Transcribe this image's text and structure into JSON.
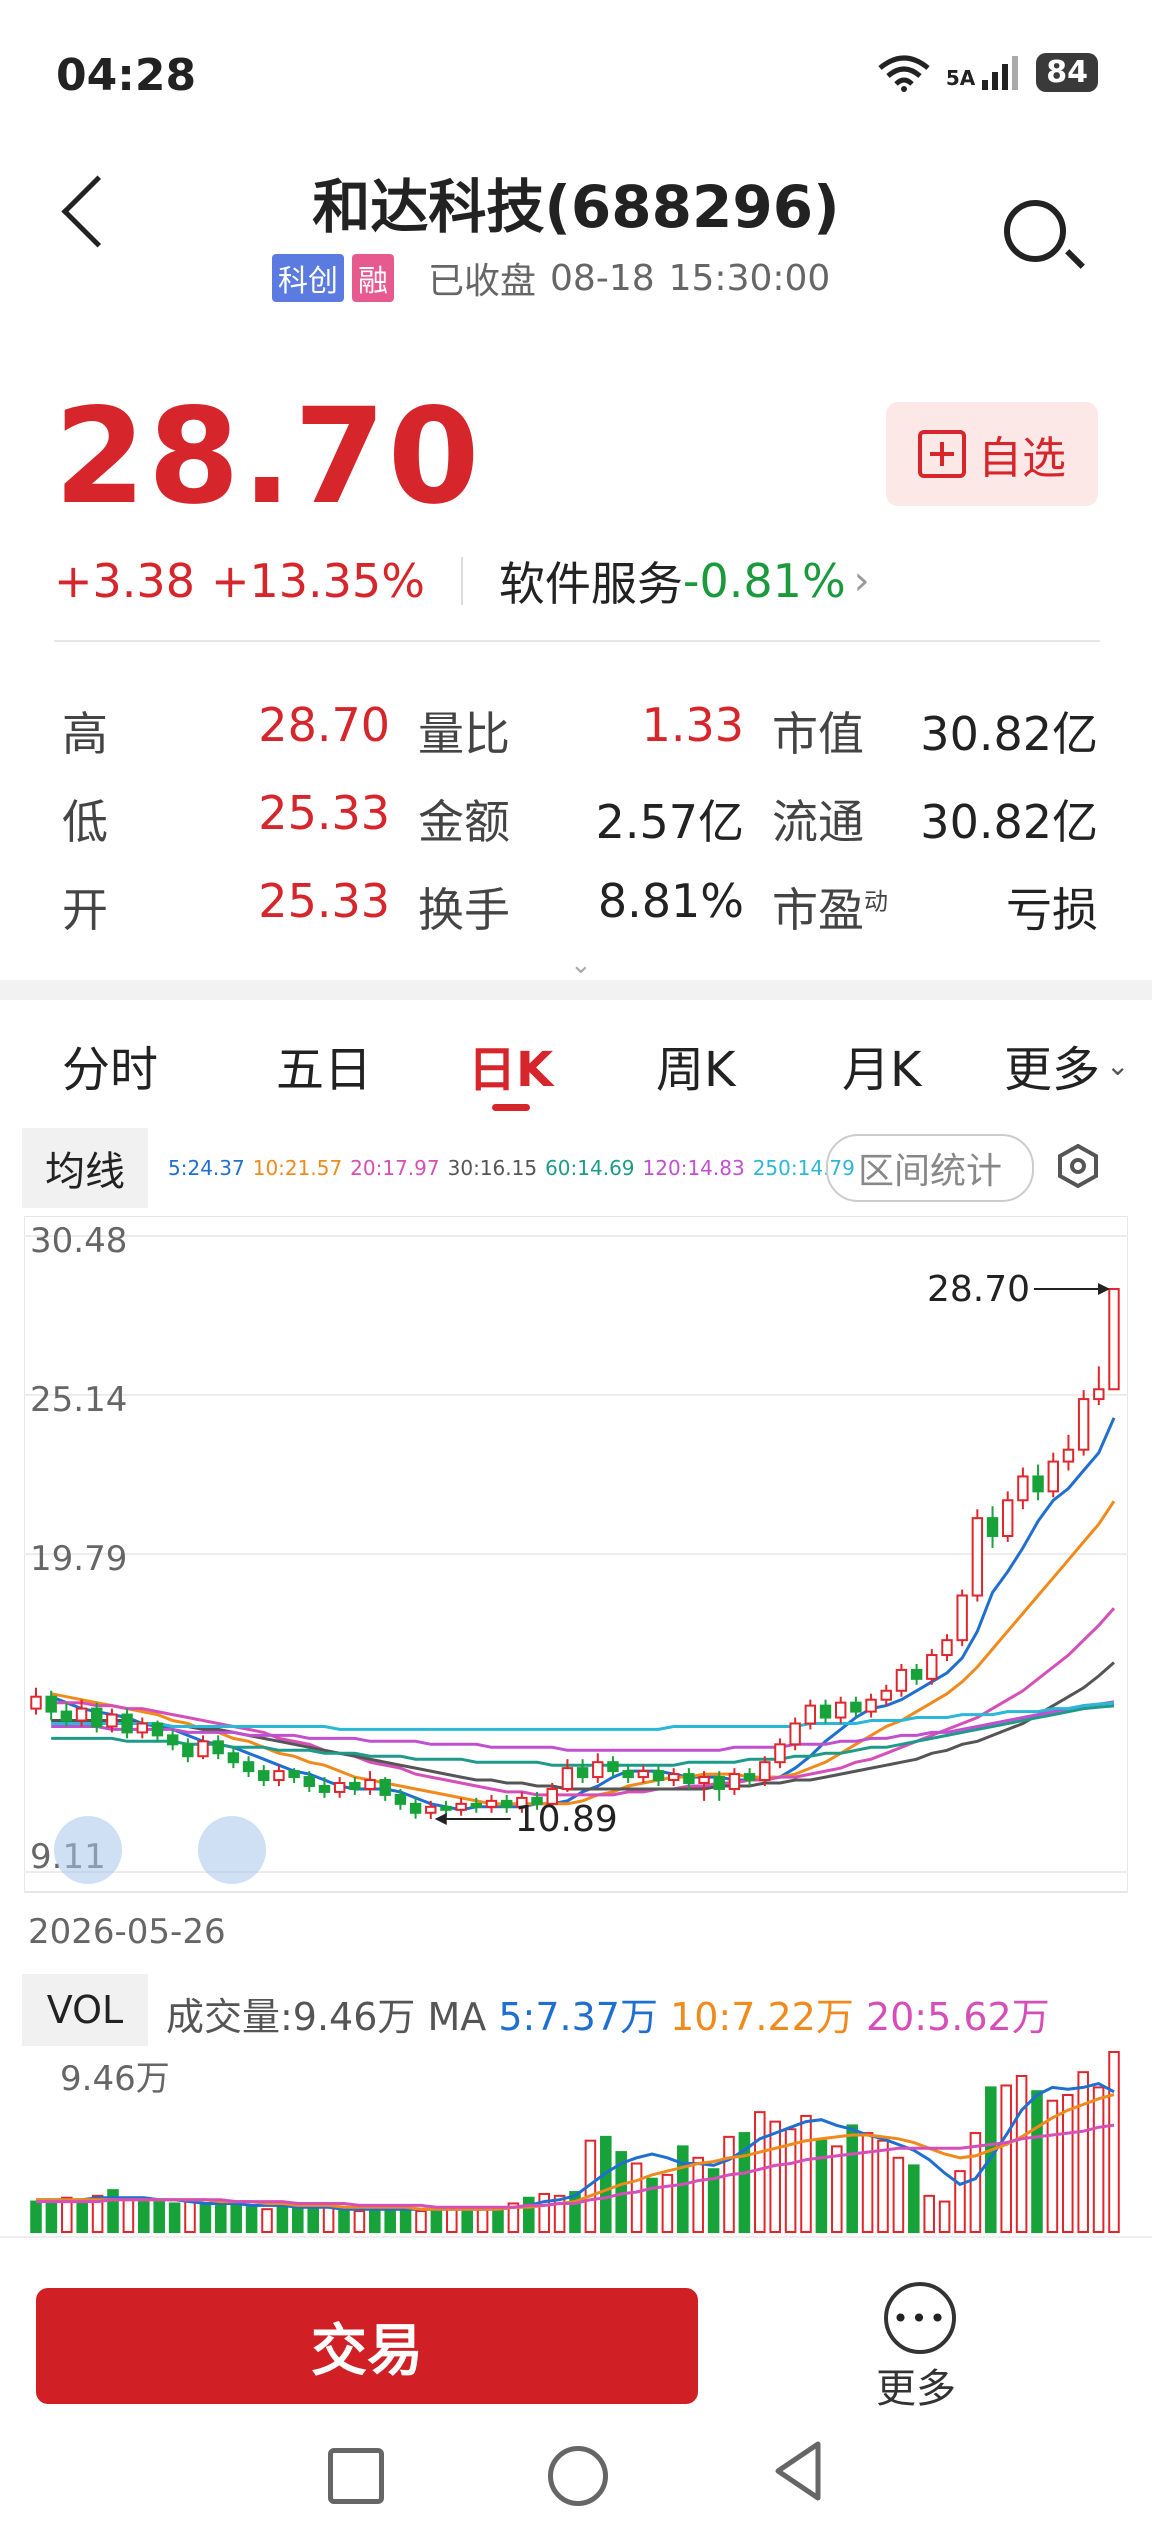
{
  "status": {
    "time": "04:28",
    "network": "5A",
    "battery": "84"
  },
  "header": {
    "title": "和达科技(688296)",
    "tag1": "科创",
    "tag2": "融",
    "status": "已收盘",
    "date": "08-18",
    "time": "15:30:00"
  },
  "quote": {
    "price": "28.70",
    "change": "+3.38",
    "change_pct": "+13.35%",
    "sector": "软件服务",
    "sector_change": "-0.81%",
    "watch_label": "自选"
  },
  "stats": [
    {
      "label": "高",
      "value": "28.70",
      "label2": "量比",
      "value2": "1.33",
      "label3": "市值",
      "value3": "30.82亿"
    },
    {
      "label": "低",
      "value": "25.33",
      "label2": "金额",
      "value2": "2.57亿",
      "label3": "流通",
      "value3": "30.82亿"
    },
    {
      "label": "开",
      "value": "25.33",
      "label2": "换手",
      "value2": "8.81%",
      "label3": "市盈",
      "label3_sup": "动",
      "value3": "亏损"
    }
  ],
  "tabs": [
    "分时",
    "五日",
    "日K",
    "周K",
    "月K",
    "更多"
  ],
  "active_tab": "日K",
  "ma": {
    "label": "均线",
    "values": [
      {
        "text": "5:24.37",
        "color": "#1f6fd1"
      },
      {
        "text": "10:21.57",
        "color": "#f08a1c"
      },
      {
        "text": "20:17.97",
        "color": "#d64fb8"
      },
      {
        "text": "30:16.15",
        "color": "#555555"
      },
      {
        "text": "60:14.69",
        "color": "#1e9a8a"
      },
      {
        "text": "120:14.83",
        "color": "#c050d0"
      },
      {
        "text": "250:14.79",
        "color": "#2ab7d8"
      }
    ],
    "range_button": "区间统计"
  },
  "chart_data": {
    "type": "candlestick",
    "y_ticks": [
      "30.48",
      "25.14",
      "19.79",
      "9.11"
    ],
    "ylim": [
      9.11,
      30.48
    ],
    "high_annotation": "28.70",
    "low_annotation": "10.89",
    "start_date": "2026-05-26",
    "candles": [
      {
        "o": 14.6,
        "c": 15.0,
        "h": 15.3,
        "l": 14.4
      },
      {
        "o": 15.0,
        "c": 14.5,
        "h": 15.2,
        "l": 14.2
      },
      {
        "o": 14.5,
        "c": 14.2,
        "h": 14.8,
        "l": 14.0
      },
      {
        "o": 14.2,
        "c": 14.6,
        "h": 14.9,
        "l": 14.0
      },
      {
        "o": 14.6,
        "c": 14.0,
        "h": 14.8,
        "l": 13.8
      },
      {
        "o": 14.0,
        "c": 14.4,
        "h": 14.6,
        "l": 13.8
      },
      {
        "o": 14.4,
        "c": 13.8,
        "h": 14.6,
        "l": 13.6
      },
      {
        "o": 13.8,
        "c": 14.1,
        "h": 14.3,
        "l": 13.6
      },
      {
        "o": 14.1,
        "c": 13.7,
        "h": 14.2,
        "l": 13.5
      },
      {
        "o": 13.7,
        "c": 13.4,
        "h": 13.9,
        "l": 13.2
      },
      {
        "o": 13.4,
        "c": 13.0,
        "h": 13.6,
        "l": 12.8
      },
      {
        "o": 13.0,
        "c": 13.5,
        "h": 13.7,
        "l": 12.9
      },
      {
        "o": 13.5,
        "c": 13.1,
        "h": 13.7,
        "l": 12.9
      },
      {
        "o": 13.1,
        "c": 12.8,
        "h": 13.3,
        "l": 12.6
      },
      {
        "o": 12.8,
        "c": 12.5,
        "h": 13.0,
        "l": 12.3
      },
      {
        "o": 12.5,
        "c": 12.2,
        "h": 12.7,
        "l": 12.0
      },
      {
        "o": 12.2,
        "c": 12.5,
        "h": 12.7,
        "l": 12.0
      },
      {
        "o": 12.5,
        "c": 12.3,
        "h": 12.6,
        "l": 12.1
      },
      {
        "o": 12.3,
        "c": 12.0,
        "h": 12.5,
        "l": 11.8
      },
      {
        "o": 12.0,
        "c": 11.8,
        "h": 12.3,
        "l": 11.6
      },
      {
        "o": 11.8,
        "c": 12.1,
        "h": 12.3,
        "l": 11.6
      },
      {
        "o": 12.1,
        "c": 11.9,
        "h": 12.3,
        "l": 11.7
      },
      {
        "o": 11.9,
        "c": 12.2,
        "h": 12.5,
        "l": 11.7
      },
      {
        "o": 12.2,
        "c": 11.7,
        "h": 12.3,
        "l": 11.5
      },
      {
        "o": 11.7,
        "c": 11.4,
        "h": 11.9,
        "l": 11.2
      },
      {
        "o": 11.4,
        "c": 11.1,
        "h": 11.6,
        "l": 10.9
      },
      {
        "o": 11.1,
        "c": 11.3,
        "h": 11.5,
        "l": 10.89
      },
      {
        "o": 11.3,
        "c": 11.2,
        "h": 11.5,
        "l": 11.0
      },
      {
        "o": 11.2,
        "c": 11.4,
        "h": 11.6,
        "l": 11.0
      },
      {
        "o": 11.4,
        "c": 11.3,
        "h": 11.6,
        "l": 11.1
      },
      {
        "o": 11.3,
        "c": 11.5,
        "h": 11.7,
        "l": 11.1
      },
      {
        "o": 11.5,
        "c": 11.3,
        "h": 11.7,
        "l": 11.1
      },
      {
        "o": 11.3,
        "c": 11.6,
        "h": 11.8,
        "l": 11.1
      },
      {
        "o": 11.6,
        "c": 11.4,
        "h": 11.8,
        "l": 11.2
      },
      {
        "o": 11.4,
        "c": 11.9,
        "h": 12.1,
        "l": 11.3
      },
      {
        "o": 11.9,
        "c": 12.6,
        "h": 12.9,
        "l": 11.8
      },
      {
        "o": 12.6,
        "c": 12.3,
        "h": 12.9,
        "l": 12.1
      },
      {
        "o": 12.3,
        "c": 12.8,
        "h": 13.1,
        "l": 12.1
      },
      {
        "o": 12.8,
        "c": 12.5,
        "h": 13.0,
        "l": 12.3
      },
      {
        "o": 12.5,
        "c": 12.3,
        "h": 12.7,
        "l": 12.1
      },
      {
        "o": 12.3,
        "c": 12.5,
        "h": 12.7,
        "l": 12.1
      },
      {
        "o": 12.5,
        "c": 12.2,
        "h": 12.7,
        "l": 12.0
      },
      {
        "o": 12.2,
        "c": 12.4,
        "h": 12.6,
        "l": 12.0
      },
      {
        "o": 12.4,
        "c": 12.1,
        "h": 12.6,
        "l": 11.9
      },
      {
        "o": 12.1,
        "c": 12.3,
        "h": 12.5,
        "l": 11.5
      },
      {
        "o": 12.3,
        "c": 11.9,
        "h": 12.5,
        "l": 11.5
      },
      {
        "o": 11.9,
        "c": 12.4,
        "h": 12.6,
        "l": 11.7
      },
      {
        "o": 12.4,
        "c": 12.2,
        "h": 12.6,
        "l": 12.0
      },
      {
        "o": 12.2,
        "c": 12.8,
        "h": 13.0,
        "l": 12.0
      },
      {
        "o": 12.8,
        "c": 13.4,
        "h": 13.6,
        "l": 12.6
      },
      {
        "o": 13.4,
        "c": 14.1,
        "h": 14.3,
        "l": 13.2
      },
      {
        "o": 14.1,
        "c": 14.7,
        "h": 14.9,
        "l": 13.9
      },
      {
        "o": 14.7,
        "c": 14.3,
        "h": 14.9,
        "l": 14.1
      },
      {
        "o": 14.3,
        "c": 14.8,
        "h": 15.0,
        "l": 14.1
      },
      {
        "o": 14.8,
        "c": 14.5,
        "h": 15.0,
        "l": 14.3
      },
      {
        "o": 14.5,
        "c": 14.9,
        "h": 15.1,
        "l": 14.3
      },
      {
        "o": 14.9,
        "c": 15.2,
        "h": 15.4,
        "l": 14.7
      },
      {
        "o": 15.2,
        "c": 15.9,
        "h": 16.1,
        "l": 15.0
      },
      {
        "o": 15.9,
        "c": 15.6,
        "h": 16.1,
        "l": 15.4
      },
      {
        "o": 15.6,
        "c": 16.4,
        "h": 16.6,
        "l": 15.4
      },
      {
        "o": 16.4,
        "c": 16.9,
        "h": 17.1,
        "l": 16.2
      },
      {
        "o": 16.9,
        "c": 18.4,
        "h": 18.6,
        "l": 16.7
      },
      {
        "o": 18.4,
        "c": 21.0,
        "h": 21.3,
        "l": 18.2
      },
      {
        "o": 21.0,
        "c": 20.4,
        "h": 21.4,
        "l": 20.0
      },
      {
        "o": 20.4,
        "c": 21.6,
        "h": 21.9,
        "l": 20.2
      },
      {
        "o": 21.6,
        "c": 22.4,
        "h": 22.7,
        "l": 21.3
      },
      {
        "o": 22.4,
        "c": 21.9,
        "h": 22.8,
        "l": 21.6
      },
      {
        "o": 21.9,
        "c": 22.9,
        "h": 23.2,
        "l": 21.7
      },
      {
        "o": 22.9,
        "c": 23.3,
        "h": 23.8,
        "l": 22.6
      },
      {
        "o": 23.3,
        "c": 25.0,
        "h": 25.3,
        "l": 23.1
      },
      {
        "o": 25.0,
        "c": 25.33,
        "h": 26.1,
        "l": 24.8
      },
      {
        "o": 25.33,
        "c": 28.7,
        "h": 28.7,
        "l": 25.33
      }
    ],
    "ma_lines": {
      "ma5": [
        15.0,
        14.8,
        14.6,
        14.5,
        14.4,
        14.3,
        14.1,
        14.0,
        13.9,
        13.7,
        13.5,
        13.4,
        13.3,
        13.1,
        12.9,
        12.7,
        12.5,
        12.4,
        12.2,
        12.0,
        11.9,
        11.9,
        11.9,
        11.8,
        11.6,
        11.4,
        11.3,
        11.2,
        11.3,
        11.3,
        11.3,
        11.3,
        11.4,
        11.4,
        11.5,
        11.8,
        12.0,
        12.3,
        12.5,
        12.5,
        12.5,
        12.4,
        12.3,
        12.3,
        12.3,
        12.2,
        12.2,
        12.2,
        12.3,
        12.6,
        13.0,
        13.5,
        13.9,
        14.3,
        14.6,
        14.7,
        14.9,
        15.2,
        15.5,
        15.8,
        16.3,
        17.2,
        18.5,
        19.2,
        20.0,
        20.9,
        21.6,
        22.0,
        22.6,
        23.2,
        24.37
      ],
      "ma10": [
        15.1,
        15.0,
        14.9,
        14.8,
        14.7,
        14.6,
        14.5,
        14.4,
        14.2,
        14.1,
        13.9,
        13.8,
        13.6,
        13.5,
        13.3,
        13.1,
        13.0,
        12.8,
        12.7,
        12.5,
        12.3,
        12.2,
        12.1,
        12.0,
        11.9,
        11.8,
        11.7,
        11.6,
        11.5,
        11.4,
        11.4,
        11.4,
        11.4,
        11.4,
        11.4,
        11.5,
        11.7,
        11.8,
        12.0,
        12.1,
        12.2,
        12.3,
        12.3,
        12.4,
        12.4,
        12.4,
        12.3,
        12.3,
        12.3,
        12.4,
        12.6,
        12.8,
        13.1,
        13.4,
        13.7,
        14.0,
        14.2,
        14.5,
        14.8,
        15.1,
        15.5,
        16.0,
        16.6,
        17.2,
        17.8,
        18.4,
        19.0,
        19.6,
        20.2,
        20.8,
        21.57
      ],
      "ma20": [
        14.8,
        14.8,
        14.8,
        14.7,
        14.7,
        14.6,
        14.6,
        14.5,
        14.4,
        14.3,
        14.2,
        14.1,
        14.0,
        13.9,
        13.8,
        13.6,
        13.5,
        13.4,
        13.2,
        13.1,
        13.0,
        12.8,
        12.7,
        12.6,
        12.4,
        12.3,
        12.2,
        12.1,
        12.0,
        11.9,
        11.8,
        11.8,
        11.7,
        11.7,
        11.7,
        11.7,
        11.7,
        11.7,
        11.8,
        11.8,
        11.9,
        11.9,
        12.0,
        12.0,
        12.1,
        12.1,
        12.2,
        12.2,
        12.3,
        12.3,
        12.4,
        12.5,
        12.6,
        12.8,
        12.9,
        13.1,
        13.3,
        13.5,
        13.7,
        13.9,
        14.1,
        14.3,
        14.6,
        14.9,
        15.2,
        15.6,
        16.0,
        16.4,
        16.9,
        17.4,
        17.97
      ],
      "ma30": [
        14.2,
        14.2,
        14.2,
        14.2,
        14.2,
        14.2,
        14.1,
        14.1,
        14.0,
        14.0,
        13.9,
        13.9,
        13.8,
        13.7,
        13.6,
        13.5,
        13.4,
        13.3,
        13.2,
        13.1,
        13.0,
        12.9,
        12.8,
        12.7,
        12.6,
        12.5,
        12.4,
        12.3,
        12.2,
        12.2,
        12.1,
        12.1,
        12.0,
        12.0,
        11.9,
        11.9,
        11.9,
        11.9,
        11.9,
        11.9,
        11.9,
        11.9,
        11.9,
        11.9,
        12.0,
        12.0,
        12.0,
        12.1,
        12.1,
        12.2,
        12.2,
        12.3,
        12.4,
        12.5,
        12.6,
        12.7,
        12.8,
        12.9,
        13.1,
        13.2,
        13.4,
        13.5,
        13.7,
        13.9,
        14.1,
        14.4,
        14.7,
        15.0,
        15.3,
        15.7,
        16.15
      ],
      "ma60": [
        13.6,
        13.6,
        13.6,
        13.6,
        13.6,
        13.5,
        13.5,
        13.5,
        13.5,
        13.4,
        13.4,
        13.4,
        13.3,
        13.3,
        13.3,
        13.2,
        13.2,
        13.2,
        13.1,
        13.1,
        13.1,
        13.0,
        13.0,
        13.0,
        12.9,
        12.9,
        12.9,
        12.9,
        12.8,
        12.8,
        12.8,
        12.8,
        12.8,
        12.7,
        12.7,
        12.7,
        12.7,
        12.7,
        12.7,
        12.7,
        12.7,
        12.7,
        12.8,
        12.8,
        12.8,
        12.8,
        12.9,
        12.9,
        12.9,
        13.0,
        13.0,
        13.1,
        13.1,
        13.2,
        13.3,
        13.3,
        13.4,
        13.5,
        13.6,
        13.7,
        13.8,
        13.9,
        14.0,
        14.1,
        14.2,
        14.3,
        14.4,
        14.5,
        14.6,
        14.65,
        14.69
      ],
      "ma120": [
        14.0,
        14.0,
        14.0,
        14.0,
        13.9,
        13.9,
        13.9,
        13.9,
        13.9,
        13.8,
        13.8,
        13.8,
        13.8,
        13.7,
        13.7,
        13.7,
        13.7,
        13.6,
        13.6,
        13.6,
        13.6,
        13.5,
        13.5,
        13.5,
        13.5,
        13.4,
        13.4,
        13.4,
        13.4,
        13.3,
        13.3,
        13.3,
        13.3,
        13.3,
        13.2,
        13.2,
        13.2,
        13.2,
        13.2,
        13.2,
        13.2,
        13.2,
        13.2,
        13.2,
        13.2,
        13.3,
        13.3,
        13.3,
        13.3,
        13.4,
        13.4,
        13.4,
        13.5,
        13.5,
        13.6,
        13.6,
        13.7,
        13.7,
        13.8,
        13.8,
        13.9,
        14.0,
        14.1,
        14.2,
        14.3,
        14.4,
        14.5,
        14.6,
        14.7,
        14.75,
        14.83
      ],
      "ma250": [
        14.1,
        14.1,
        14.1,
        14.1,
        14.1,
        14.1,
        14.1,
        14.1,
        14.0,
        14.0,
        14.0,
        14.0,
        14.0,
        14.0,
        14.0,
        14.0,
        14.0,
        14.0,
        14.0,
        13.9,
        13.9,
        13.9,
        13.9,
        13.9,
        13.9,
        13.9,
        13.9,
        13.9,
        13.9,
        13.9,
        13.9,
        13.9,
        13.9,
        13.9,
        13.9,
        13.9,
        13.9,
        13.9,
        13.9,
        13.9,
        13.9,
        14.0,
        14.0,
        14.0,
        14.0,
        14.0,
        14.0,
        14.0,
        14.0,
        14.0,
        14.1,
        14.1,
        14.1,
        14.1,
        14.2,
        14.2,
        14.2,
        14.3,
        14.3,
        14.3,
        14.4,
        14.4,
        14.4,
        14.5,
        14.5,
        14.5,
        14.6,
        14.6,
        14.7,
        14.75,
        14.79
      ]
    },
    "volume": {
      "label": "VOL",
      "info_prefix": "成交量:9.46万 MA",
      "ma5_text": "5:7.37万",
      "ma10_text": "10:7.22万",
      "ma20_text": "20:5.62万",
      "max_label": "9.46万",
      "ylim": [
        0,
        9.46
      ],
      "bars": [
        1.6,
        1.7,
        1.8,
        1.6,
        1.9,
        2.2,
        1.8,
        1.7,
        1.6,
        1.5,
        1.6,
        1.4,
        1.5,
        1.4,
        1.3,
        1.2,
        1.4,
        1.3,
        1.2,
        1.3,
        1.2,
        1.1,
        1.2,
        1.3,
        1.2,
        1.1,
        1.3,
        1.2,
        1.1,
        1.2,
        1.3,
        1.5,
        1.8,
        2.0,
        1.9,
        2.1,
        4.8,
        5.0,
        4.2,
        3.6,
        2.8,
        3.0,
        4.5,
        3.9,
        3.3,
        5.0,
        5.2,
        6.3,
        5.8,
        5.4,
        6.1,
        4.8,
        4.5,
        5.6,
        5.2,
        4.8,
        3.9,
        3.5,
        1.9,
        1.6,
        3.2,
        5.2,
        7.6,
        7.7,
        8.2,
        7.4,
        6.9,
        7.2,
        8.4,
        7.6,
        9.46
      ],
      "ma5": [
        1.7,
        1.7,
        1.7,
        1.7,
        1.8,
        1.8,
        1.8,
        1.8,
        1.7,
        1.7,
        1.6,
        1.5,
        1.5,
        1.5,
        1.4,
        1.4,
        1.4,
        1.3,
        1.3,
        1.3,
        1.2,
        1.2,
        1.2,
        1.2,
        1.2,
        1.2,
        1.2,
        1.2,
        1.2,
        1.2,
        1.2,
        1.3,
        1.4,
        1.6,
        1.7,
        1.9,
        2.5,
        3.1,
        3.6,
        3.9,
        4.1,
        3.9,
        3.6,
        3.6,
        3.5,
        3.8,
        4.3,
        4.9,
        5.2,
        5.5,
        5.8,
        5.9,
        5.6,
        5.4,
        5.1,
        4.9,
        4.6,
        4.3,
        3.8,
        3.1,
        2.5,
        2.8,
        3.9,
        5.1,
        6.4,
        7.2,
        7.6,
        7.5,
        7.6,
        7.8,
        7.37
      ],
      "ma10": [
        1.7,
        1.7,
        1.7,
        1.7,
        1.7,
        1.7,
        1.7,
        1.7,
        1.7,
        1.7,
        1.7,
        1.7,
        1.6,
        1.6,
        1.6,
        1.5,
        1.5,
        1.4,
        1.4,
        1.4,
        1.3,
        1.3,
        1.3,
        1.3,
        1.3,
        1.2,
        1.2,
        1.2,
        1.2,
        1.2,
        1.2,
        1.3,
        1.3,
        1.4,
        1.5,
        1.6,
        1.9,
        2.2,
        2.5,
        2.7,
        3.0,
        3.2,
        3.4,
        3.6,
        3.7,
        3.9,
        4.0,
        4.2,
        4.4,
        4.6,
        4.8,
        4.9,
        5.0,
        5.1,
        5.1,
        5.0,
        4.9,
        4.7,
        4.4,
        4.1,
        3.9,
        4.0,
        4.3,
        4.6,
        5.0,
        5.5,
        6.0,
        6.4,
        6.7,
        7.0,
        7.22
      ],
      "ma20": [
        1.6,
        1.6,
        1.6,
        1.6,
        1.6,
        1.7,
        1.7,
        1.7,
        1.7,
        1.7,
        1.7,
        1.7,
        1.7,
        1.6,
        1.6,
        1.6,
        1.6,
        1.5,
        1.5,
        1.5,
        1.5,
        1.4,
        1.4,
        1.4,
        1.4,
        1.4,
        1.3,
        1.3,
        1.3,
        1.3,
        1.3,
        1.3,
        1.4,
        1.4,
        1.5,
        1.5,
        1.7,
        1.8,
        2.0,
        2.1,
        2.3,
        2.4,
        2.5,
        2.7,
        2.8,
        3.0,
        3.1,
        3.3,
        3.5,
        3.6,
        3.8,
        3.9,
        4.0,
        4.1,
        4.2,
        4.3,
        4.4,
        4.4,
        4.4,
        4.4,
        4.4,
        4.5,
        4.6,
        4.7,
        4.9,
        5.0,
        5.1,
        5.2,
        5.3,
        5.5,
        5.62
      ]
    }
  },
  "bottom": {
    "trade_label": "交易",
    "more_label": "更多"
  }
}
